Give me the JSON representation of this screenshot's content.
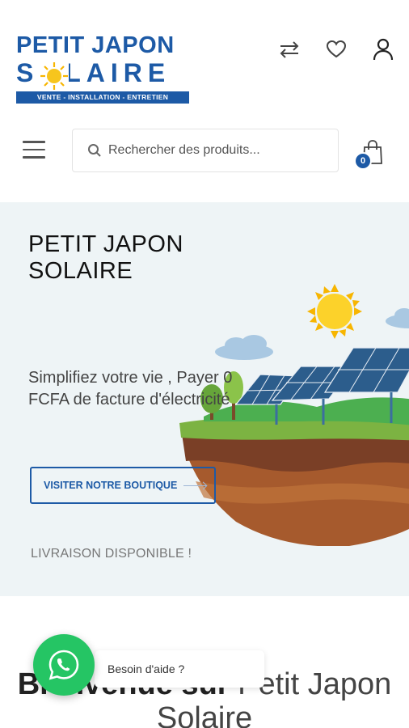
{
  "brand": {
    "line1": "PETIT JAPON",
    "line2": "SOLAIRE",
    "tagline": "VENTE - INSTALLATION - ENTRETIEN",
    "primary_color": "#1d5aa6",
    "sun_color": "#f7c51d"
  },
  "header": {
    "icons": [
      "compare-icon",
      "heart-icon",
      "user-icon"
    ],
    "menu_icon": "hamburger-icon",
    "search": {
      "placeholder": "Rechercher des produits..."
    },
    "cart": {
      "count": "0"
    }
  },
  "hero": {
    "title": "PETIT JAPON SOLAIRE",
    "subtitle": "Simplifiez votre vie , Payer 0 FCFA de facture d'électricité",
    "cta": "VISITER NOTRE BOUTIQUE",
    "delivery": "LIVRAISON DISPONIBLE !",
    "background": "#eef4f6"
  },
  "welcome": {
    "bold": "Bienvenue sur",
    "light": "Petit Japon Solaire"
  },
  "whatsapp": {
    "label": "Besoin d'aide ?",
    "color": "#25c564"
  }
}
